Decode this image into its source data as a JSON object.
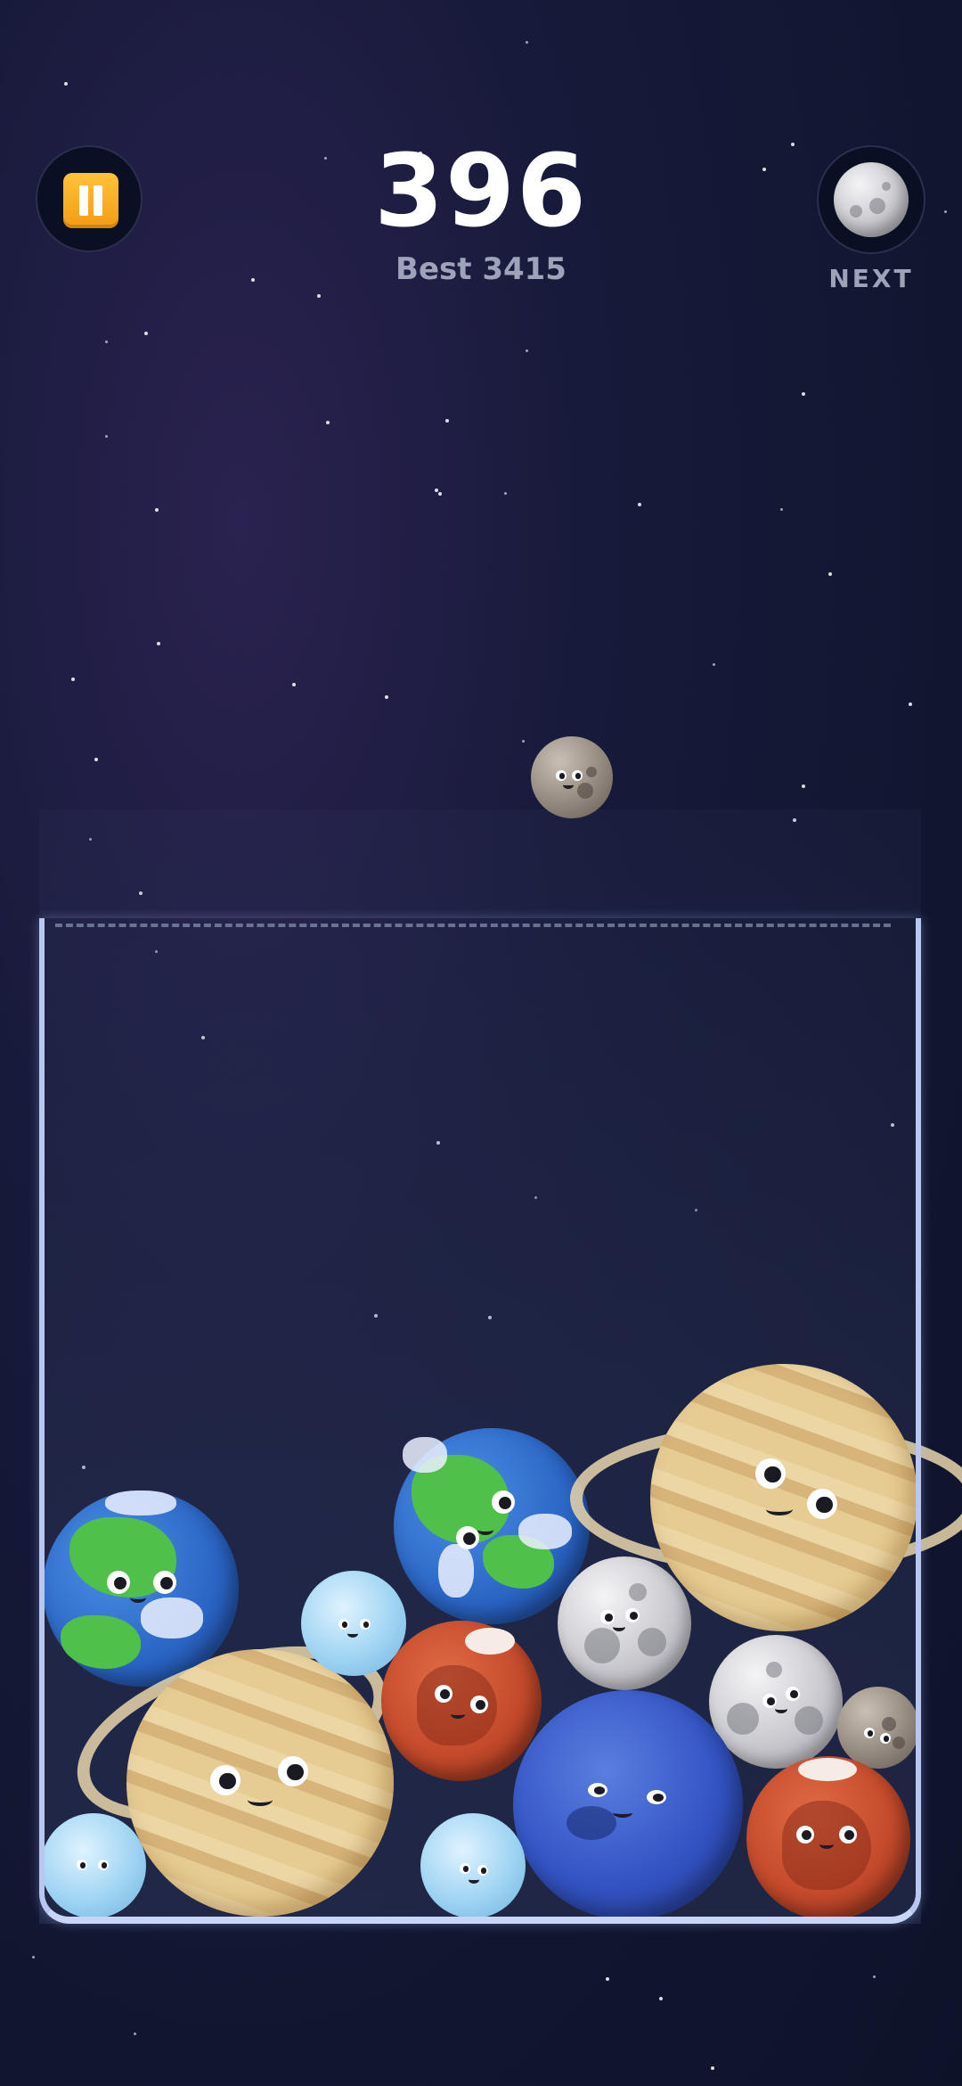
{
  "hud": {
    "score": "396",
    "best": "Best 3415",
    "next_label": "NEXT",
    "next_planet": "moon",
    "pause_icon": "pause-icon"
  },
  "dropper": {
    "planet": "rocky-moon"
  },
  "board": {
    "planets": [
      "earth",
      "ice",
      "saturn",
      "earth",
      "moon",
      "saturn",
      "mars",
      "moon",
      "rocky-moon",
      "neptune",
      "mars",
      "ice",
      "ice"
    ]
  },
  "colors": {
    "accent": "#f39c12",
    "background": "#111630",
    "jar_glass": "#b9c7f0"
  }
}
